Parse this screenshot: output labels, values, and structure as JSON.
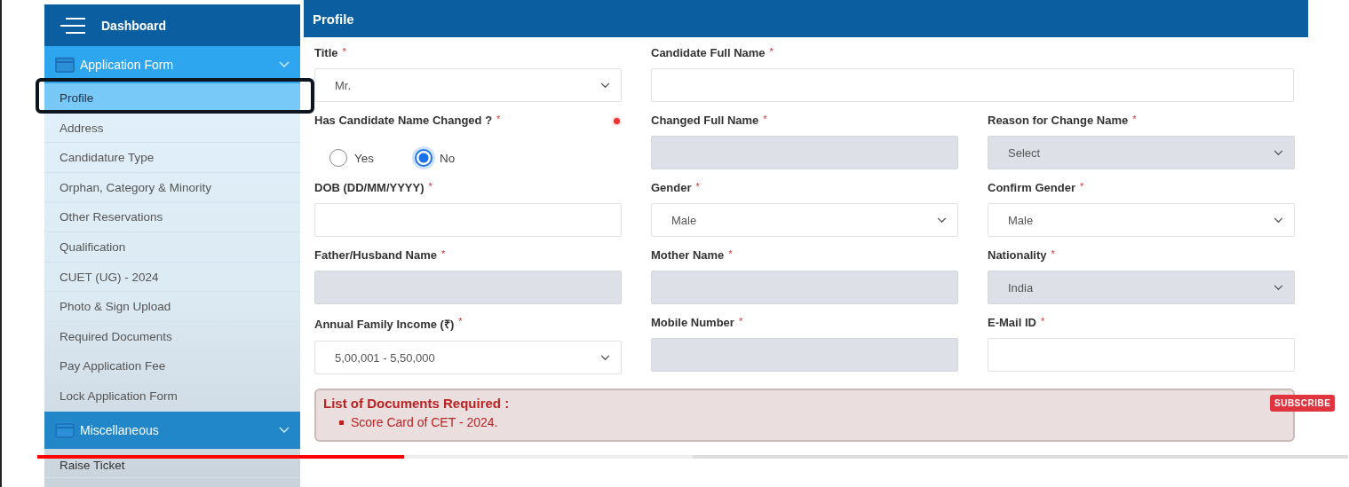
{
  "sidebar": {
    "title": "Dashboard",
    "groups": [
      {
        "label": "Application Form",
        "expanded": true,
        "items": [
          {
            "label": "Profile",
            "selected": true
          },
          {
            "label": "Address",
            "selected": false
          },
          {
            "label": "Candidature Type",
            "selected": false
          },
          {
            "label": "Orphan, Category & Minority",
            "selected": false
          },
          {
            "label": "Other Reservations",
            "selected": false
          },
          {
            "label": "Qualification",
            "selected": false
          },
          {
            "label": "CUET (UG) - 2024",
            "selected": false
          },
          {
            "label": "Photo & Sign Upload",
            "selected": false
          },
          {
            "label": "Required Documents",
            "selected": false
          },
          {
            "label": "Pay Application Fee",
            "selected": false
          },
          {
            "label": "Lock Application Form",
            "selected": false
          }
        ]
      },
      {
        "label": "Miscellaneous",
        "expanded": true,
        "items": [
          {
            "label": "Raise Ticket",
            "selected": false
          }
        ]
      }
    ]
  },
  "form": {
    "title": "Profile",
    "rows": [
      [
        {
          "kind": "select",
          "label": "Title",
          "mark": "*",
          "value": "Mr.",
          "disabled": false
        },
        {
          "kind": "text",
          "label": "Candidate Full Name",
          "mark": "*",
          "disabled": false,
          "wide": true
        }
      ],
      [
        {
          "kind": "radio",
          "label": "Has Candidate Name Changed ?",
          "mark": "*",
          "options": [
            {
              "label": "Yes",
              "selected": false
            },
            {
              "label": "No",
              "selected": true
            }
          ]
        },
        {
          "kind": "text",
          "label": "Changed Full Name",
          "mark": "*",
          "disabled": true
        },
        {
          "kind": "select",
          "label": "Reason for Change Name",
          "mark": "*",
          "value": "Select",
          "disabled": true
        }
      ],
      [
        {
          "kind": "text",
          "label": "DOB (DD/MM/YYYY)",
          "mark": "*",
          "disabled": false
        },
        {
          "kind": "select",
          "label": "Gender",
          "mark": "*",
          "value": "Male",
          "disabled": false
        },
        {
          "kind": "select",
          "label": "Confirm Gender",
          "mark": "*",
          "value": "Male",
          "disabled": false
        }
      ],
      [
        {
          "kind": "text",
          "label": "Father/Husband Name",
          "mark": "*",
          "disabled": true
        },
        {
          "kind": "text",
          "label": "Mother Name",
          "mark": "*",
          "disabled": true
        },
        {
          "kind": "select",
          "label": "Nationality",
          "mark": "*",
          "value": "India",
          "disabled": true
        }
      ],
      [
        {
          "kind": "select",
          "label": "Annual Family Income (₹)",
          "mark": "*",
          "value": "5,00,001 - 5,50,000",
          "disabled": false
        },
        {
          "kind": "text",
          "label": "Mobile Number",
          "mark": "*",
          "disabled": true
        },
        {
          "kind": "text",
          "label": "E-Mail ID",
          "mark": "*",
          "disabled": false
        }
      ]
    ],
    "documents": {
      "title": "List of Documents Required :",
      "items": [
        "Score Card of CET - 2024."
      ]
    }
  },
  "player": {
    "subscribe": "SUBSCRIBE",
    "progress": {
      "level": 0.28
    }
  }
}
